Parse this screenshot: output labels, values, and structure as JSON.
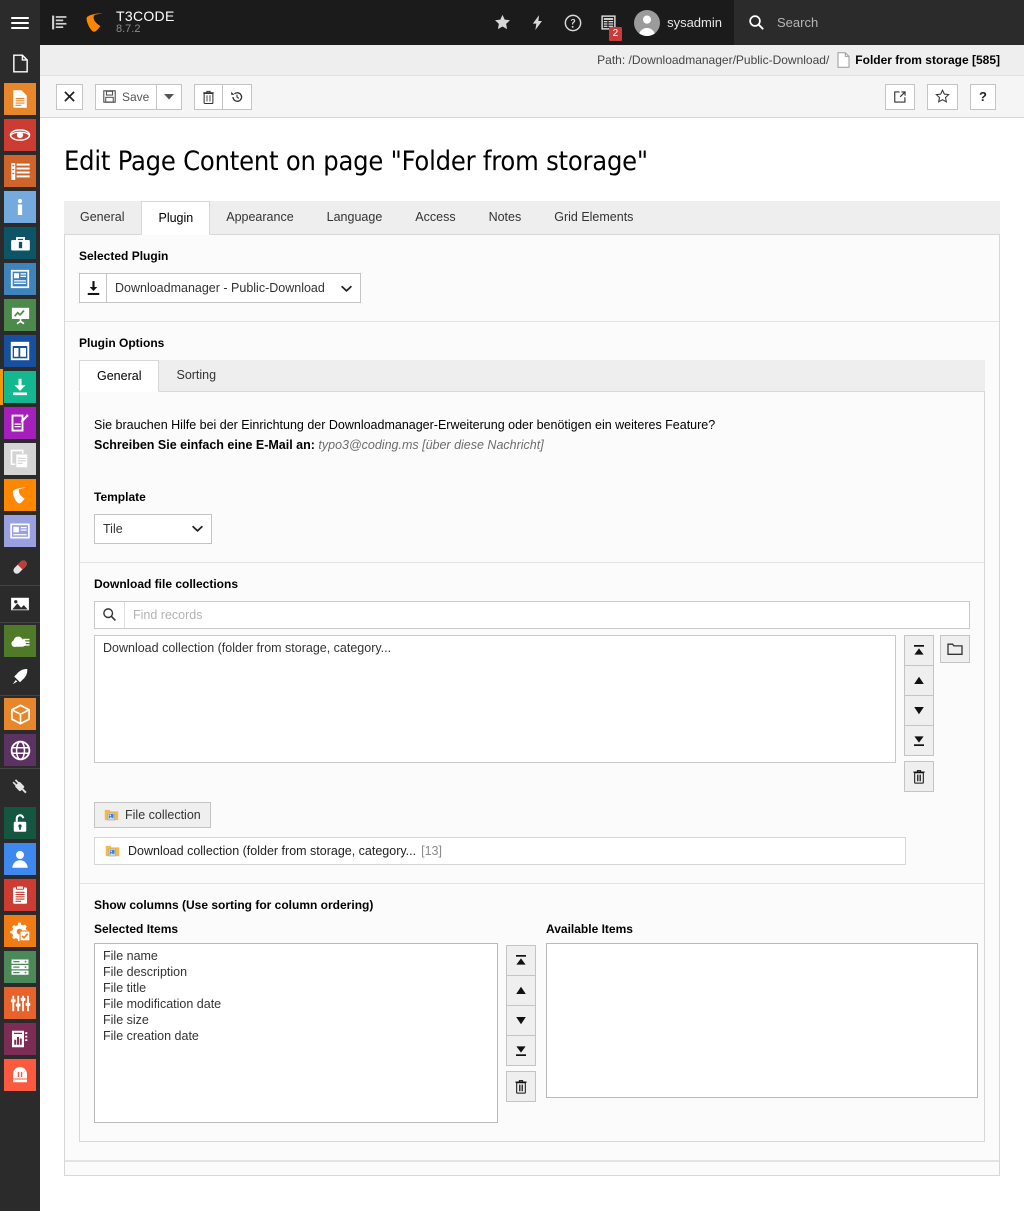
{
  "topbar": {
    "logo_title": "T3CODE",
    "logo_version": "8.7.2",
    "icons": {
      "menu": "hamburger-icon",
      "list": "list-icon",
      "bookmark": "star-icon",
      "flash": "flash-icon",
      "help": "question-circle-icon",
      "clipboard": "clipboard-list-icon"
    },
    "notification_count": "2",
    "username": "sysadmin",
    "search_placeholder": "Search",
    "search_value": ""
  },
  "modulemenu": {
    "items": [
      {
        "name": "page-blank",
        "color": "#2b2b2b",
        "glyph": "page"
      },
      {
        "name": "page",
        "color": "#e8862b",
        "glyph": "page-lines"
      },
      {
        "name": "view",
        "color": "#cc3c33",
        "glyph": "eye"
      },
      {
        "name": "list",
        "color": "#d1642a",
        "glyph": "list"
      },
      {
        "name": "info",
        "color": "#74aadd",
        "glyph": "info"
      },
      {
        "name": "functions",
        "color": "#0b5566",
        "glyph": "toolbox"
      },
      {
        "name": "templates",
        "color": "#3f83bd",
        "glyph": "news"
      },
      {
        "name": "seo",
        "color": "#4b8a4b",
        "glyph": "chart-board"
      },
      {
        "name": "layout",
        "color": "#17509e",
        "glyph": "window"
      },
      {
        "name": "download",
        "color": "#14b890",
        "glyph": "download"
      },
      {
        "name": "forms",
        "color": "#a51fba",
        "glyph": "form"
      },
      {
        "name": "copy",
        "color": "#d4d4d4",
        "glyph": "copy"
      },
      {
        "name": "typo3",
        "color": "#ff8700",
        "glyph": "typo3"
      },
      {
        "name": "news",
        "color": "#9aa0e0",
        "glyph": "id-card"
      },
      {
        "name": "pill",
        "color": "#2b2b2b",
        "glyph": "pill"
      },
      {
        "name": "filelist",
        "color": "#2b2b2b",
        "glyph": "image"
      },
      {
        "name": "cloud",
        "color": "#4f7a28",
        "glyph": "cloud"
      },
      {
        "name": "rocket",
        "color": "#2b2b2b",
        "glyph": "rocket"
      },
      {
        "name": "extensions",
        "color": "#e8862b",
        "glyph": "box"
      },
      {
        "name": "languages",
        "color": "#5c3262",
        "glyph": "globe"
      },
      {
        "name": "plug",
        "color": "#2b2b2b",
        "glyph": "plug"
      },
      {
        "name": "access",
        "color": "#14563f",
        "glyph": "unlock"
      },
      {
        "name": "backend-users",
        "color": "#3f89ee",
        "glyph": "user"
      },
      {
        "name": "logs",
        "color": "#cc3c33",
        "glyph": "clipboard"
      },
      {
        "name": "settings",
        "color": "#f07c13",
        "glyph": "gear-check"
      },
      {
        "name": "database",
        "color": "#4b8a58",
        "glyph": "server"
      },
      {
        "name": "configuration",
        "color": "#e8622b",
        "glyph": "sliders"
      },
      {
        "name": "reports",
        "color": "#7d2c55",
        "glyph": "report"
      },
      {
        "name": "install",
        "color": "#fb5a3f",
        "glyph": "install"
      }
    ]
  },
  "pathline": {
    "label": "Path: /Downloadmanager/Public-Download/",
    "record": "Folder from storage [585]"
  },
  "docheader": {
    "close_label": "close-icon",
    "save_label": "Save",
    "save_dropdown": "chevron-down-icon",
    "delete_label": "trash-icon",
    "history_label": "history-icon",
    "open_label": "open-in-new-icon",
    "bookmark_label": "star-icon",
    "help_label": "?"
  },
  "page": {
    "title": "Edit Page Content on page \"Folder from storage\""
  },
  "tabs": [
    {
      "label": "General",
      "active": false
    },
    {
      "label": "Plugin",
      "active": true
    },
    {
      "label": "Appearance",
      "active": false
    },
    {
      "label": "Language",
      "active": false
    },
    {
      "label": "Access",
      "active": false
    },
    {
      "label": "Notes",
      "active": false
    },
    {
      "label": "Grid Elements",
      "active": false
    }
  ],
  "selected_plugin": {
    "label": "Selected Plugin",
    "icon": "download-icon",
    "value": "Downloadmanager - Public-Download"
  },
  "plugin_options": {
    "label": "Plugin Options",
    "tabs": [
      {
        "label": "General",
        "active": true
      },
      {
        "label": "Sorting",
        "active": false
      }
    ],
    "notice_line1": "Sie brauchen Hilfe bei der Einrichtung der Downloadmanager-Erweiterung oder benötigen ein weiteres Feature?",
    "notice_line2_bold": "Schreiben Sie einfach eine E-Mail an:",
    "notice_mail": "typo3@coding.ms [über diese Nachricht]"
  },
  "template": {
    "label": "Template",
    "value": "Tile"
  },
  "download_collections": {
    "label": "Download file collections",
    "search_placeholder": "Find records",
    "search_value": "",
    "options": [
      "Download collection (folder from storage, category..."
    ],
    "controls": [
      {
        "name": "move-to-top-button",
        "glyph": "top"
      },
      {
        "name": "move-up-button",
        "glyph": "up"
      },
      {
        "name": "move-down-button",
        "glyph": "down"
      },
      {
        "name": "move-to-bottom-button",
        "glyph": "bottom"
      },
      {
        "name": "remove-button",
        "glyph": "trash"
      }
    ],
    "browse_button": "folder-icon",
    "add_button_label": "File collection",
    "record": {
      "title": "Download collection (folder from storage, category...",
      "uid": "[13]"
    }
  },
  "show_columns": {
    "label": "Show columns (Use sorting for column ordering)",
    "selected_label": "Selected Items",
    "available_label": "Available Items",
    "selected_items": [
      "File name",
      "File description",
      "File title",
      "File modification date",
      "File size",
      "File creation date"
    ],
    "available_items": [],
    "controls": [
      {
        "name": "move-to-top-button",
        "glyph": "top"
      },
      {
        "name": "move-up-button",
        "glyph": "up"
      },
      {
        "name": "move-down-button",
        "glyph": "down"
      },
      {
        "name": "move-to-bottom-button",
        "glyph": "bottom"
      },
      {
        "name": "remove-button",
        "glyph": "trash"
      }
    ]
  },
  "colors": {
    "brand_orange": "#ff8700",
    "topbar_bg": "#1b1b1b",
    "module_bg": "#2b2b2b",
    "badge_red": "#c83c3c"
  }
}
